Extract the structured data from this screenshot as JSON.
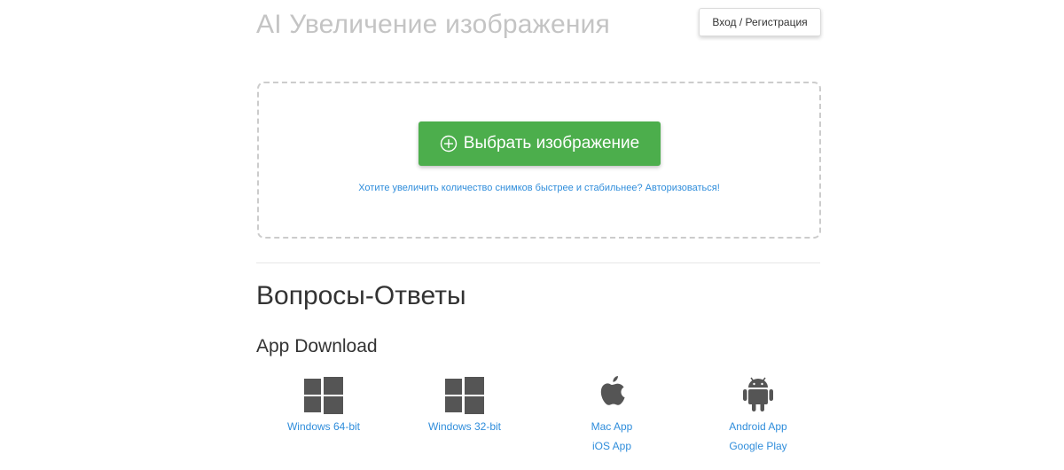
{
  "header": {
    "title": "AI Увеличение изображения",
    "login_label": "Вход / Регистрация"
  },
  "upload": {
    "button_label": "Выбрать изображение",
    "hint": "Хотите увеличить количество снимков быстрее и стабильнее? Авторизоваться!"
  },
  "faq": {
    "heading": "Вопросы-Ответы"
  },
  "apps": {
    "heading": "App Download",
    "items": [
      {
        "icon": "windows-icon",
        "links": [
          "Windows 64-bit"
        ]
      },
      {
        "icon": "windows-icon",
        "links": [
          "Windows 32-bit"
        ]
      },
      {
        "icon": "apple-icon",
        "links": [
          "Mac App",
          "iOS App"
        ]
      },
      {
        "icon": "android-icon",
        "links": [
          "Android App",
          "Google Play"
        ]
      }
    ]
  },
  "colors": {
    "accent_green": "#4cae4c",
    "link_blue": "#2f8ddb",
    "title_gray": "#c4c4c4",
    "icon_gray": "#555555"
  }
}
